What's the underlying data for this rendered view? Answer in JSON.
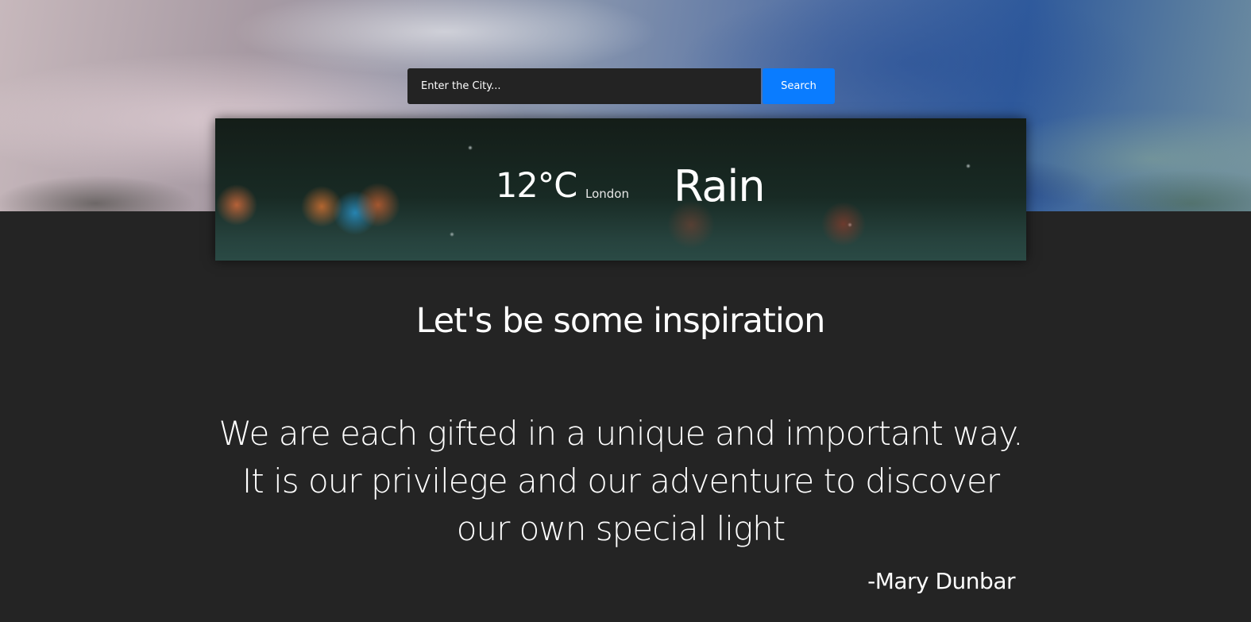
{
  "search": {
    "placeholder": "Enter the City...",
    "button_label": "Search"
  },
  "weather": {
    "temperature": "12°C",
    "city": "London",
    "condition": "Rain"
  },
  "inspiration": {
    "heading": "Let's be some inspiration",
    "quote": "We are each gifted in a unique and important way. It is our privilege and our adventure to discover our own special light",
    "author": "-Mary Dunbar"
  },
  "colors": {
    "page_background": "#242424",
    "search_input_background": "#232323",
    "search_button": "#0a7cff",
    "text": "#ffffff"
  }
}
